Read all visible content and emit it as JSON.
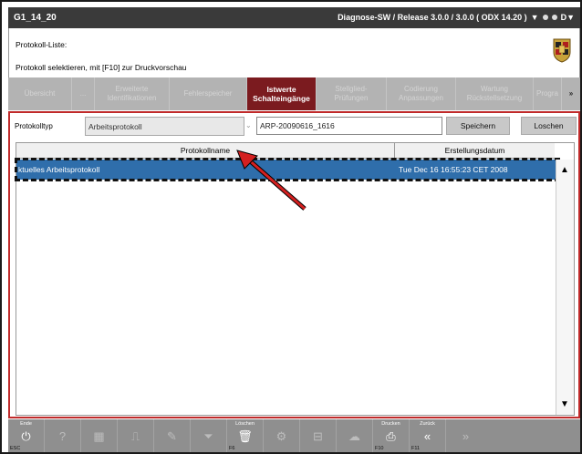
{
  "window": {
    "title": "G1_14_20",
    "status": "Diagnose-SW / Release 3.0.0 / 3.0.0  ( ODX  14.20 )",
    "status_right": "D▼"
  },
  "header": {
    "title": "Protokoll-Liste:",
    "instruction": "Protokoll selektieren, mit [F10] zur Druckvorschau"
  },
  "tabs": [
    {
      "label": "Übersicht"
    },
    {
      "label": "..."
    },
    {
      "label": "Erweiterte Identifikationen"
    },
    {
      "label": "Fehlerspeicher"
    },
    {
      "label": "Istwerte Schalteingänge"
    },
    {
      "label": "Stellglied-Prüfungen"
    },
    {
      "label": "Codierung Anpassungen"
    },
    {
      "label": "Wartung Rückstellsetzung"
    },
    {
      "label": "Progra"
    },
    {
      "label": "»"
    }
  ],
  "controls": {
    "type_label": "Protokolltyp",
    "type_value": "Arbeitsprotokoll",
    "name_value": "ARP-20090616_1616",
    "save_label": "Speichern",
    "delete_label": "Loschen"
  },
  "table": {
    "columns": [
      "Protokollname",
      "Erstellungsdatum"
    ],
    "rows": [
      {
        "name": "ktuelles Arbeitsprotokoll",
        "date": "Tue Dec 16 16:55:23 CET 2008"
      }
    ]
  },
  "toolbar": [
    {
      "caption": "Ende",
      "key": "ESC",
      "icon": "power-icon"
    },
    {
      "caption": "",
      "key": "",
      "icon": "help-icon"
    },
    {
      "caption": "",
      "key": "",
      "icon": "keyboard-icon"
    },
    {
      "caption": "",
      "key": "",
      "icon": "graph-icon"
    },
    {
      "caption": "",
      "key": "",
      "icon": "pen-icon"
    },
    {
      "caption": "",
      "key": "",
      "icon": "filter-icon"
    },
    {
      "caption": "Löschen",
      "key": "F6",
      "icon": "trash-icon"
    },
    {
      "caption": "",
      "key": "",
      "icon": "wrench-icon"
    },
    {
      "caption": "",
      "key": "",
      "icon": "plug-icon"
    },
    {
      "caption": "",
      "key": "",
      "icon": "chat-icon"
    },
    {
      "caption": "Drucken",
      "key": "F10",
      "icon": "print-icon"
    },
    {
      "caption": "Zurück",
      "key": "F11",
      "icon": "back-icon"
    },
    {
      "caption": "",
      "key": "",
      "icon": "forward-icon"
    }
  ],
  "colors": {
    "active_tab": "#7b1b1f",
    "selection": "#2f6eab",
    "content_border": "#c02a2a"
  }
}
